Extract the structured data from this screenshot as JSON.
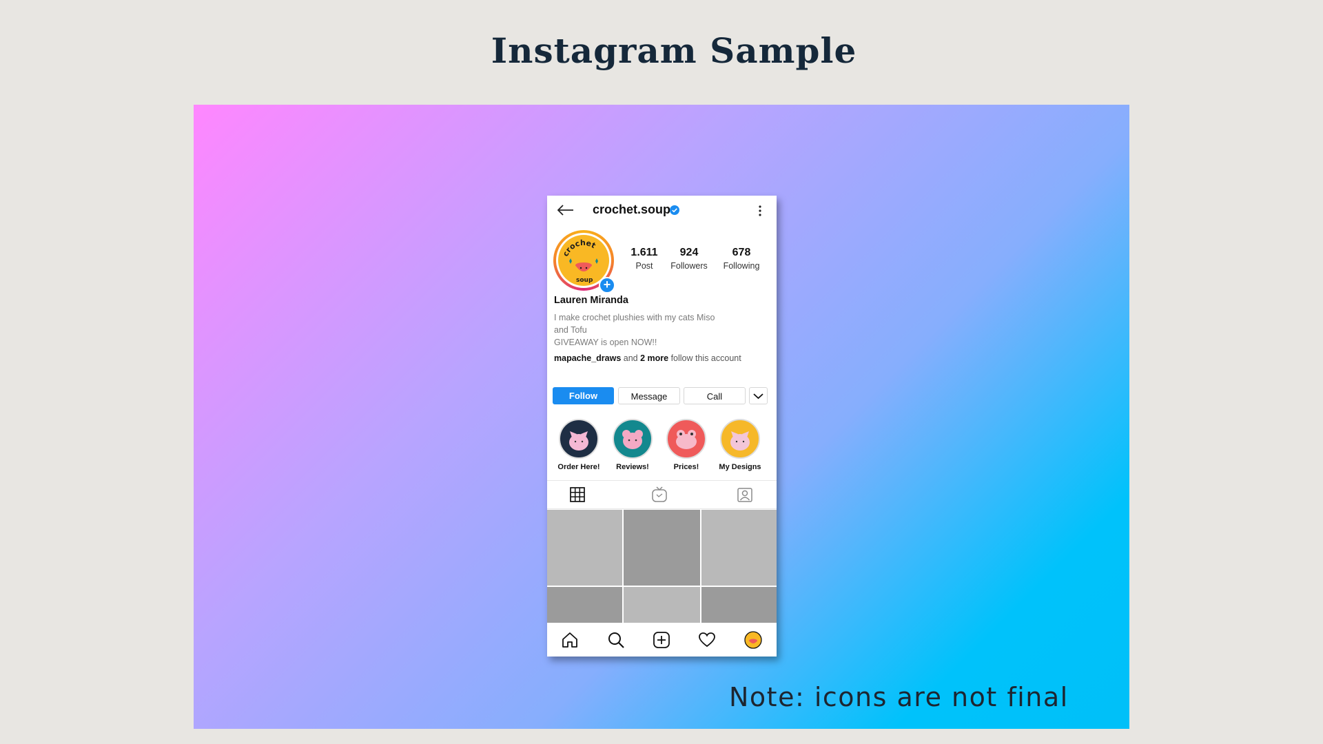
{
  "slide": {
    "title": "Instagram Sample",
    "note": "Note: icons are not final"
  },
  "profile": {
    "username": "crochet.soup",
    "full_name": "Lauren Miranda",
    "bio_lines": [
      "I make crochet plushies with my cats Miso",
      "and Tofu",
      "GIVEAWAY is open NOW!!"
    ],
    "followed_by_user": "mapache_draws",
    "followed_by_mid": " and ",
    "followed_by_more": "2 more",
    "followed_by_tail": " follow this account",
    "avatar_text": "crochet soup"
  },
  "stats": [
    {
      "value": "1.611",
      "label": "Post"
    },
    {
      "value": "924",
      "label": "Followers"
    },
    {
      "value": "678",
      "label": "Following"
    }
  ],
  "buttons": {
    "follow": "Follow",
    "message": "Message",
    "call": "Call"
  },
  "highlights": [
    {
      "label": "Order Here!",
      "color": "#1e2e44"
    },
    {
      "label": "Reviews!",
      "color": "#13888e"
    },
    {
      "label": "Prices!",
      "color": "#ef5a5a"
    },
    {
      "label": "My Designs",
      "color": "#f6b829"
    }
  ],
  "colors": {
    "accent": "#1a8cf0",
    "grid_light": "#b9b9b9",
    "grid_dark": "#9b9b9b"
  },
  "icons": {
    "back": "arrow-left-icon",
    "verified": "verified-badge-icon",
    "more": "more-vertical-icon",
    "tab_grid": "grid-icon",
    "tab_igtv": "igtv-icon",
    "tab_tagged": "tagged-user-icon",
    "nav_home": "home-icon",
    "nav_search": "search-icon",
    "nav_add": "add-post-icon",
    "nav_activity": "heart-icon",
    "nav_profile": "profile-avatar-icon"
  }
}
